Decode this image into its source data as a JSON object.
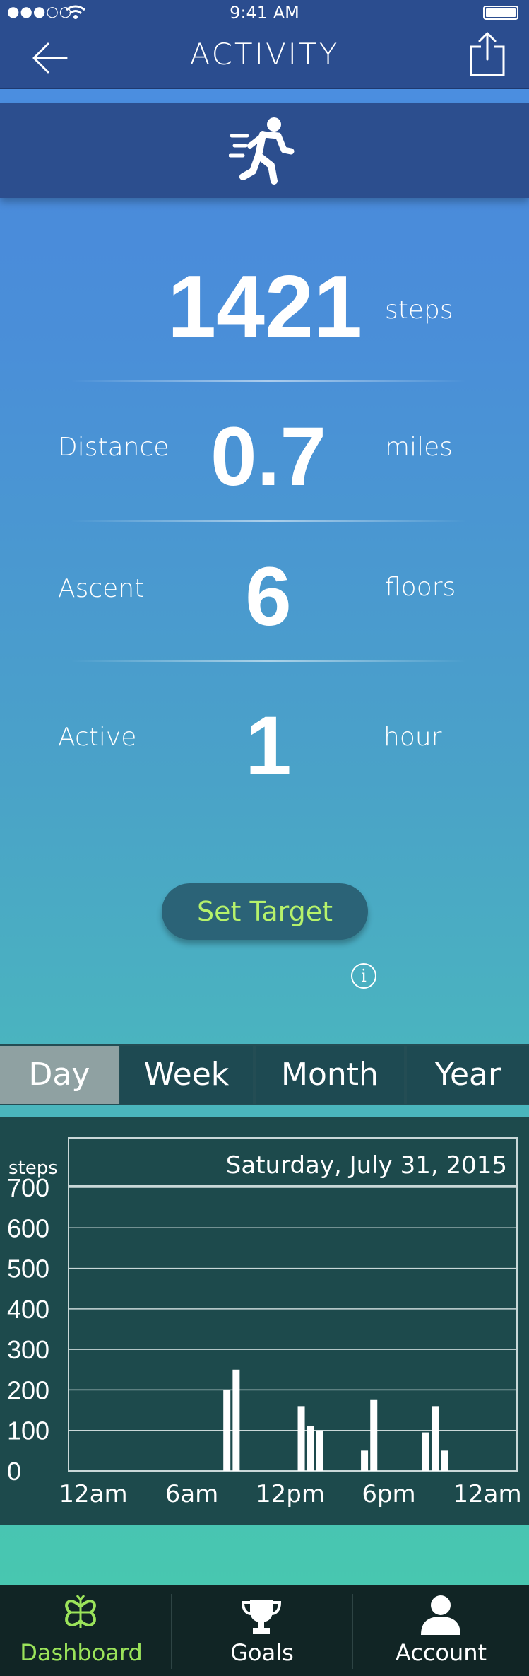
{
  "status_bar": {
    "signal": "●●●○○",
    "time": "9:41 AM"
  },
  "nav": {
    "title": "ACTIVITY",
    "back_icon": "back-arrow-icon",
    "share_icon": "share-icon"
  },
  "activity_icon": "running-person-icon",
  "metrics": {
    "steps": {
      "value": "1421",
      "unit": "steps"
    },
    "distance": {
      "label": "Distance",
      "value": "0.7",
      "unit": "miles"
    },
    "ascent": {
      "label": "Ascent",
      "value": "6",
      "unit": "floors"
    },
    "active": {
      "label": "Active",
      "value": "1",
      "unit": "hour"
    }
  },
  "set_target": {
    "label": "Set Target"
  },
  "info_icon": "info-icon",
  "period_tabs": {
    "day": "Day",
    "week": "Week",
    "month": "Month",
    "year": "Year",
    "selected": "Day"
  },
  "chart_data": {
    "type": "bar",
    "title": "Saturday, July 31, 2015",
    "ylabel": "steps",
    "ylim": [
      0,
      700
    ],
    "yticks": [
      "700",
      "600",
      "500",
      "400",
      "300",
      "200",
      "100",
      "0"
    ],
    "xticks": [
      "12am",
      "6am",
      "12pm",
      "6pm",
      "12am"
    ],
    "xlim": [
      0,
      24
    ],
    "x": [
      8.4,
      8.9,
      12.4,
      12.9,
      13.4,
      15.8,
      16.3,
      19.1,
      19.6,
      20.1
    ],
    "values": [
      200,
      250,
      160,
      110,
      100,
      50,
      175,
      95,
      160,
      50
    ]
  },
  "bottom_tabs": {
    "dashboard": {
      "label": "Dashboard",
      "icon": "clover-icon",
      "color": "#9be35a"
    },
    "goals": {
      "label": "Goals",
      "icon": "trophy-icon"
    },
    "account": {
      "label": "Account",
      "icon": "person-icon"
    }
  },
  "colors": {
    "nav": "#2b4d8f",
    "accent_green": "#b6f26b",
    "chart_panel": "#1d4a4c",
    "tab_selected": "#8fa1a2"
  }
}
